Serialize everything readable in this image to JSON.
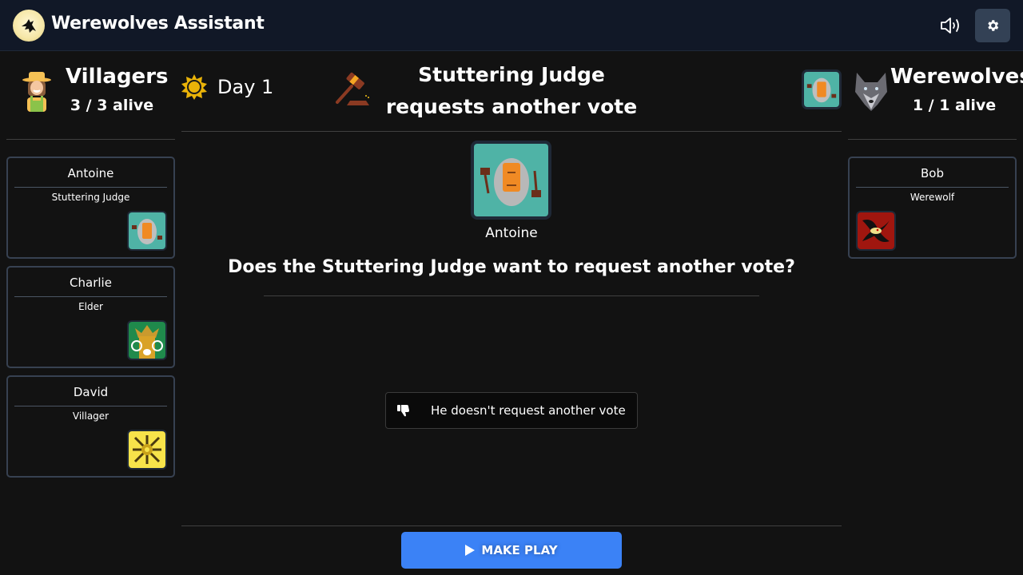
{
  "header": {
    "app_title": "Werewolves Assistant",
    "logo_icon": "howling-wolf-moon-icon",
    "sound_icon": "speaker-icon",
    "settings_icon": "gear-icon"
  },
  "villagers": {
    "title": "Villagers",
    "alive": "3 / 3 alive",
    "icon": "villager-farmer-icon",
    "players": [
      {
        "name": "Antoine",
        "role": "Stuttering Judge",
        "role_icon": "stuttering-judge-card"
      },
      {
        "name": "Charlie",
        "role": "Elder",
        "role_icon": "elder-card"
      },
      {
        "name": "David",
        "role": "Villager",
        "role_icon": "villager-card"
      }
    ]
  },
  "werewolves": {
    "title": "Werewolves",
    "alive": "1 / 1 alive",
    "icon": "wolf-head-icon",
    "players": [
      {
        "name": "Bob",
        "role": "Werewolf",
        "role_icon": "werewolf-card"
      }
    ]
  },
  "game": {
    "day_label": "Day 1",
    "day_icon": "sun-icon",
    "event_icon": "gavel-icon",
    "event_title_line1": "Stuttering Judge",
    "event_title_line2": "requests another vote",
    "event_role_icon": "stuttering-judge-card",
    "target_player": "Antoine",
    "question": "Does the Stuttering Judge want to request another vote?",
    "choices": [
      {
        "label": "He doesn't request another vote",
        "icon": "thumbs-down-icon"
      }
    ],
    "make_play_label": "MAKE PLAY",
    "make_play_icon": "play-icon"
  },
  "colors": {
    "background": "#121212",
    "topbar": "#111827",
    "primary": "#3b82f6",
    "card_border": "#374151",
    "settings_button": "#334155"
  }
}
